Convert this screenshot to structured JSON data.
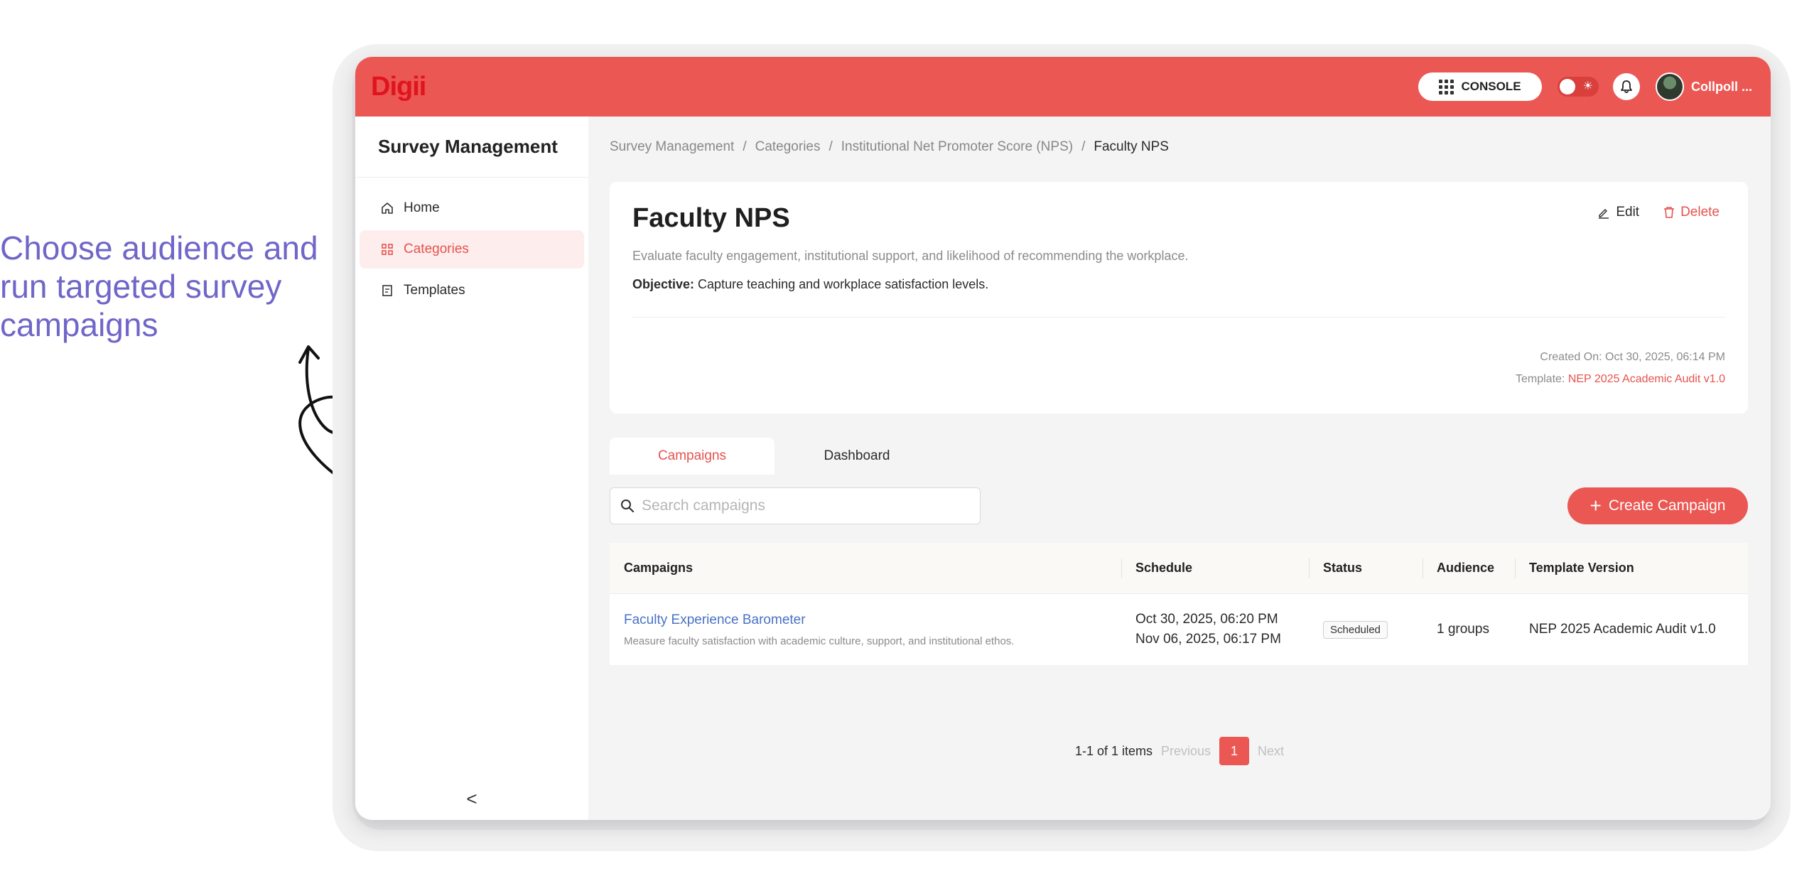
{
  "annotation": {
    "text": "Choose audience and run targeted survey campaigns",
    "color": "#6f66c9"
  },
  "header": {
    "logo": "Digii",
    "console_label": "CONSOLE",
    "username": "Collpoll ...",
    "accent_color": "#eb5753"
  },
  "sidebar": {
    "title": "Survey Management",
    "items": [
      {
        "label": "Home",
        "icon": "home-icon",
        "active": false
      },
      {
        "label": "Categories",
        "icon": "grid-icon",
        "active": true
      },
      {
        "label": "Templates",
        "icon": "template-icon",
        "active": false
      }
    ],
    "collapse_glyph": "<"
  },
  "breadcrumb": {
    "items": [
      "Survey Management",
      "Categories",
      "Institutional Net Promoter Score (NPS)"
    ],
    "current": "Faculty NPS",
    "separator": "/"
  },
  "category": {
    "title": "Faculty NPS",
    "description": "Evaluate faculty engagement, institutional support, and likelihood of recommending the workplace.",
    "objective_label": "Objective:",
    "objective": "Capture teaching and workplace satisfaction levels.",
    "edit_label": "Edit",
    "delete_label": "Delete",
    "created_label": "Created On:",
    "created_value": "Oct 30, 2025, 06:14 PM",
    "template_label": "Template:",
    "template_value": "NEP 2025 Academic Audit v1.0"
  },
  "tabs": [
    {
      "label": "Campaigns",
      "active": true
    },
    {
      "label": "Dashboard",
      "active": false
    }
  ],
  "search": {
    "placeholder": "Search campaigns",
    "value": ""
  },
  "create_button": {
    "label": "Create Campaign",
    "icon": "plus-icon"
  },
  "table": {
    "headers": [
      "Campaigns",
      "Schedule",
      "Status",
      "Audience",
      "Template Version"
    ],
    "rows": [
      {
        "name": "Faculty Experience Barometer",
        "description": "Measure faculty satisfaction with academic culture, support, and institutional ethos.",
        "schedule_start": "Oct 30, 2025, 06:20 PM",
        "schedule_end": "Nov 06, 2025, 06:17 PM",
        "status": "Scheduled",
        "audience": "1 groups",
        "template_version": "NEP 2025 Academic Audit v1.0"
      }
    ]
  },
  "pagination": {
    "info": "1-1 of 1 items",
    "previous": "Previous",
    "current_page": "1",
    "next": "Next"
  }
}
